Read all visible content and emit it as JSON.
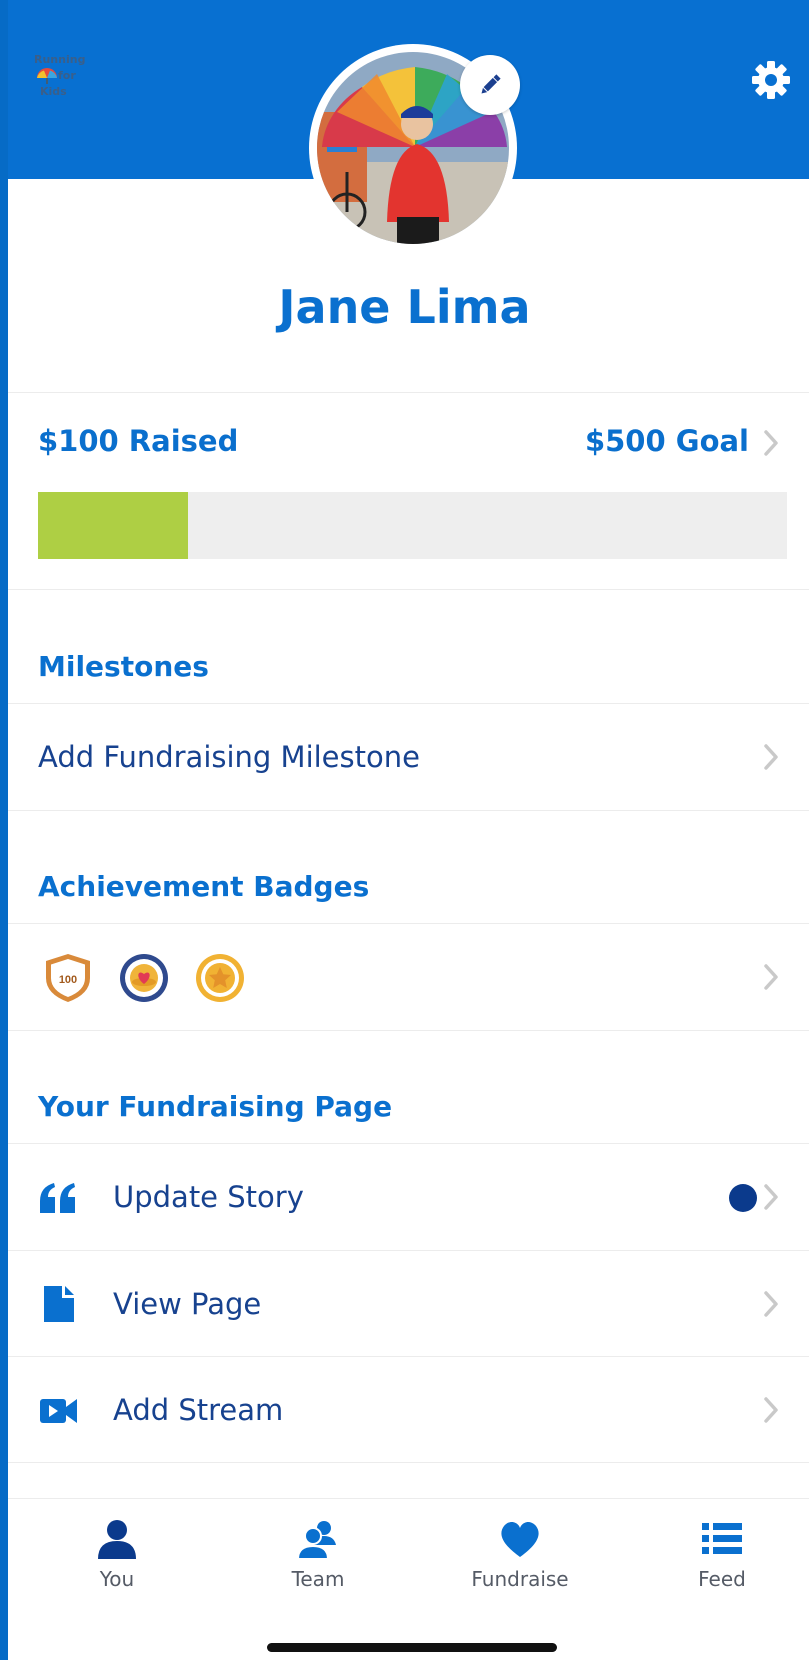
{
  "profile": {
    "name": "Jane Lima"
  },
  "header": {
    "logo_text": [
      "Running",
      "for",
      "Kids"
    ]
  },
  "fundraising": {
    "raised_label": "$100 Raised",
    "goal_label": "$500 Goal",
    "progress_fraction": 0.2
  },
  "milestones": {
    "title": "Milestones",
    "add_label": "Add Fundraising Milestone"
  },
  "badges": {
    "title": "Achievement Badges",
    "items": [
      {
        "icon": "shield-100-badge-icon",
        "text": "100"
      },
      {
        "icon": "heart-coin-badge-icon"
      },
      {
        "icon": "star-badge-icon"
      }
    ]
  },
  "fundraising_page": {
    "title": "Your Fundraising Page",
    "items": [
      {
        "icon": "quote-icon",
        "label": "Update Story",
        "has_notification_dot": true
      },
      {
        "icon": "document-icon",
        "label": "View Page"
      },
      {
        "icon": "video-camera-icon",
        "label": "Add Stream"
      }
    ]
  },
  "tabbar": {
    "items": [
      {
        "icon": "person-icon",
        "label": "You"
      },
      {
        "icon": "team-icon",
        "label": "Team"
      },
      {
        "icon": "heart-icon",
        "label": "Fundraise"
      },
      {
        "icon": "list-icon",
        "label": "Feed"
      }
    ]
  },
  "colors": {
    "header_blue": "#0870d1",
    "accent_blue": "#0a70cf",
    "progress_green": "#aecf44",
    "dark_navy": "#0b3a8c"
  }
}
